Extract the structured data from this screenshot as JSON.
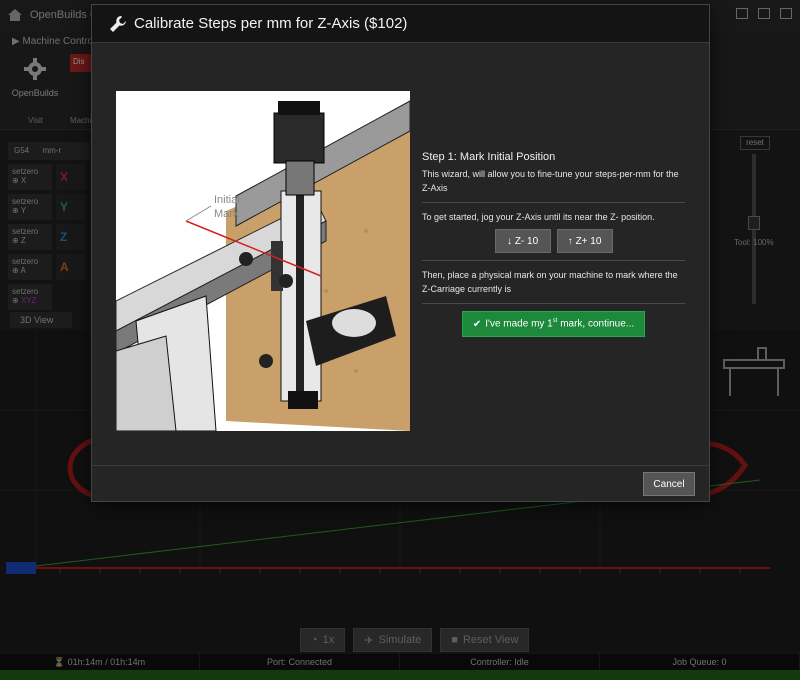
{
  "app": {
    "title": "OpenBuilds CO",
    "ribbon": {
      "tab_label": "Machine Control",
      "openbuilds_label": "OpenBuilds",
      "disconnect_label": "Dis",
      "visit_label": "Visit",
      "machine_label": "Machi"
    },
    "dro": {
      "wcs": "G54",
      "units": "mm-r",
      "rows": [
        {
          "setzero": "setzero",
          "axis": "X",
          "color": "#e03030"
        },
        {
          "setzero": "setzero",
          "axis": "Y",
          "color": "#3bb34a"
        },
        {
          "setzero": "setzero",
          "axis": "Z",
          "color": "#2f8fd8"
        },
        {
          "setzero": "setzero",
          "axis": "A",
          "color": "#e07020"
        },
        {
          "setzero": "setzero",
          "axis": "XYZ",
          "color": "#d040d0"
        }
      ]
    },
    "view_tab": "3D View",
    "right_panel": {
      "reset_label": "reset",
      "tool_label": "Tool: 100%"
    },
    "bottom": {
      "speed_label": "1x",
      "simulate_label": "Simulate",
      "reset_view_label": "Reset View"
    },
    "status": {
      "time": "01h:14m / 01h:14m",
      "port": "Port: Connected",
      "controller": "Controller: Idle",
      "queue": "Job Queue: 0"
    }
  },
  "modal": {
    "title": "Calibrate Steps per mm for Z-Axis ($102)",
    "illustration_label": "Initial Mark",
    "step_title": "Step 1: Mark Initial Position",
    "intro": "This wizard, will allow you to fine-tune your steps-per-mm for the Z-Axis",
    "jog_instruction": "To get started, jog your Z-Axis until its near the Z- position.",
    "jog_minus_label": "Z- 10",
    "jog_plus_label": "Z+ 10",
    "mark_instruction": "Then, place a physical mark on your machine to mark where the Z-Carriage currently is",
    "continue_prefix": "I've made my 1",
    "continue_sup": "st",
    "continue_suffix": " mark, continue...",
    "cancel_label": "Cancel"
  },
  "colors": {
    "accent_green": "#1c8a3a",
    "danger_red": "#c32b2b"
  }
}
